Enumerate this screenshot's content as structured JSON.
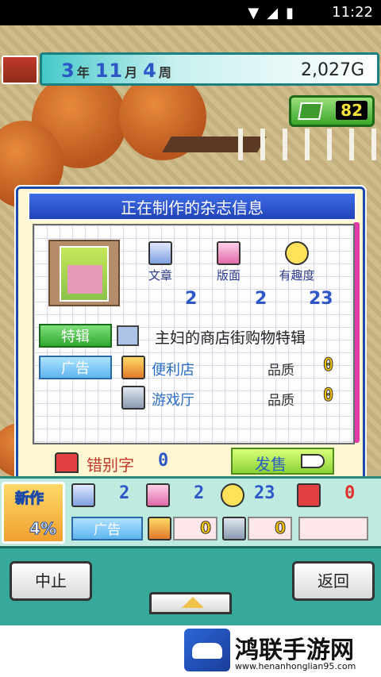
{
  "status_bar": {
    "time": "11:22"
  },
  "hud": {
    "year": "3",
    "year_unit": "年",
    "month": "11",
    "month_unit": "月",
    "week": "4",
    "week_unit": "周",
    "money": "2,027G",
    "book_count": "82"
  },
  "panel": {
    "title": "正在制作的杂志信息",
    "stats": [
      {
        "label": "文章",
        "value": "2",
        "icon": "article-icon"
      },
      {
        "label": "版面",
        "value": "2",
        "icon": "layout-icon"
      },
      {
        "label": "有趣度",
        "value": "23",
        "icon": "smiley-icon"
      }
    ],
    "feature": {
      "tag": "特辑",
      "text": "主妇的商店街购物特辑"
    },
    "ad_tag": "广告",
    "ads": [
      {
        "name": "便利店",
        "quality_label": "品质",
        "quality": "0"
      },
      {
        "name": "游戏厅",
        "quality_label": "品质",
        "quality": "0"
      }
    ],
    "typo_label": "错别字",
    "typo_value": "0",
    "publish_label": "发售"
  },
  "bottom": {
    "new_label": "新作",
    "new_percent": "4%",
    "article_value": "2",
    "layout_value": "2",
    "fun_value": "23",
    "typo_value": "0",
    "ad_tag": "广告",
    "slot1_value": "0",
    "slot2_value": "0"
  },
  "controls": {
    "stop_label": "中止",
    "back_label": "返回"
  },
  "footer": {
    "brand": "鸿联手游网",
    "site": "www.henanhonglian95.com"
  },
  "colors": {
    "title_blue": "#2143b8",
    "accent_green": "#3aa62a",
    "value_blue": "#2d57c7",
    "quality_yellow": "#f5c400"
  }
}
